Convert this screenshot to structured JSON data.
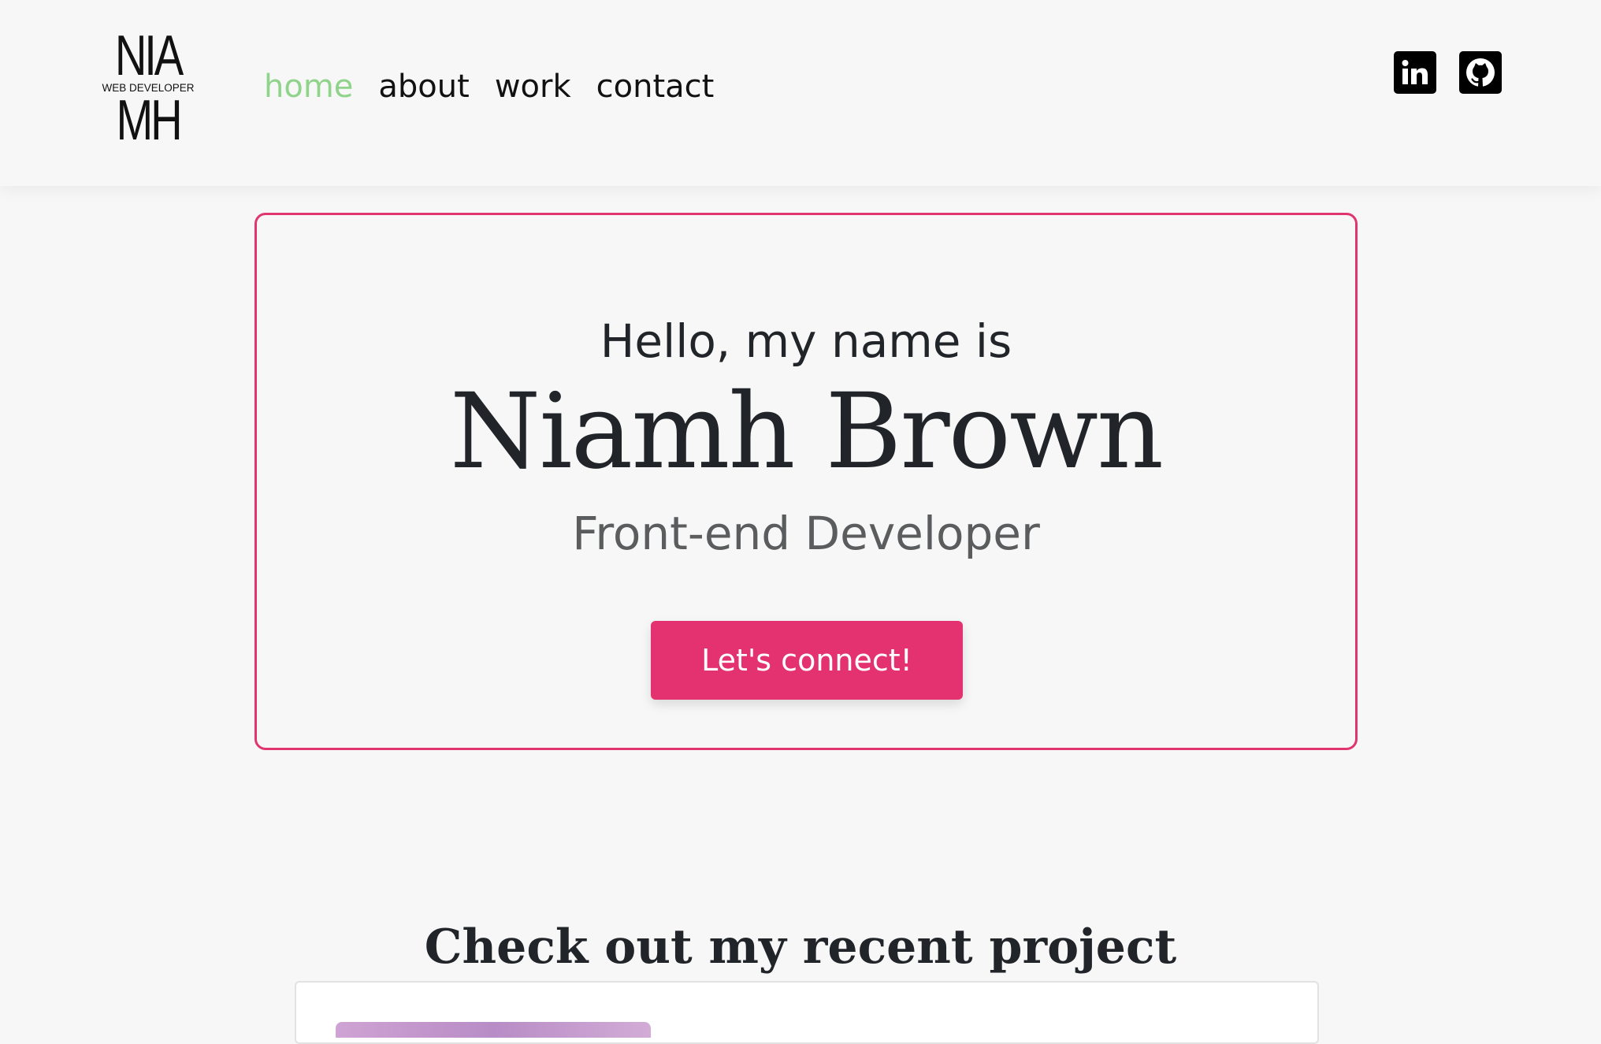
{
  "logo": {
    "top": "NIA",
    "tagline": "WEB DEVELOPER",
    "bottom": "MH"
  },
  "nav": {
    "items": [
      {
        "label": "home",
        "active": true
      },
      {
        "label": "about",
        "active": false
      },
      {
        "label": "work",
        "active": false
      },
      {
        "label": "contact",
        "active": false
      }
    ],
    "active_color": "#8fd48a"
  },
  "social": [
    {
      "name": "linkedin",
      "icon": "linkedin-icon"
    },
    {
      "name": "github",
      "icon": "github-icon"
    }
  ],
  "hero": {
    "greeting": "Hello, my name is",
    "name": "Niamh Brown",
    "role": "Front-end Developer",
    "cta_label": "Let's connect!",
    "accent_color": "#e3326f"
  },
  "projects": {
    "title": "Check out my recent project"
  }
}
